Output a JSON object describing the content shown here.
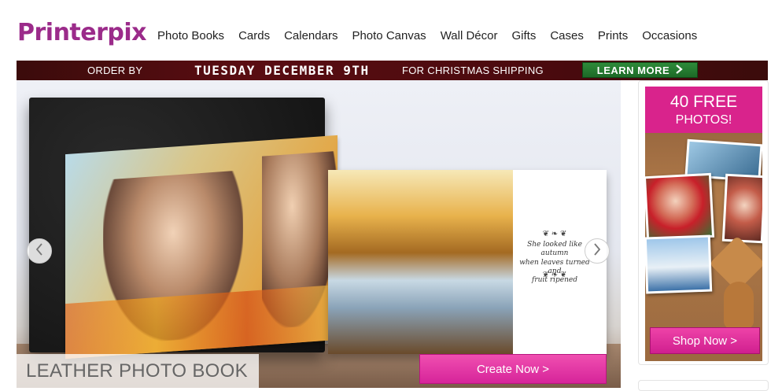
{
  "brand": {
    "name": "Printerpix",
    "color": "#9b2b8a"
  },
  "nav": {
    "items": [
      "Photo Books",
      "Cards",
      "Calendars",
      "Photo Canvas",
      "Wall Décor",
      "Gifts",
      "Cases",
      "Prints",
      "Occasions"
    ]
  },
  "promo": {
    "order_by": "ORDER BY",
    "date": "TUESDAY DECEMBER 9TH",
    "shipping": "FOR CHRISTMAS SHIPPING",
    "learn_more": "LEARN MORE",
    "learn_more_icon": "chevron-right-icon",
    "accent": "#2e8b3a"
  },
  "hero": {
    "caption": "LEATHER PHOTO BOOK",
    "cta": "Create Now >",
    "cta_color": "#e0329f",
    "quote_lines": [
      "She looked like autumn",
      "when leaves turned and",
      "fruit ripened"
    ],
    "prev_icon": "chevron-left-icon",
    "next_icon": "chevron-right-icon"
  },
  "sidebar_ad": {
    "headline": "40 FREE",
    "subline": "PHOTOS!",
    "cta": "Shop Now >",
    "accent": "#d9238c"
  }
}
